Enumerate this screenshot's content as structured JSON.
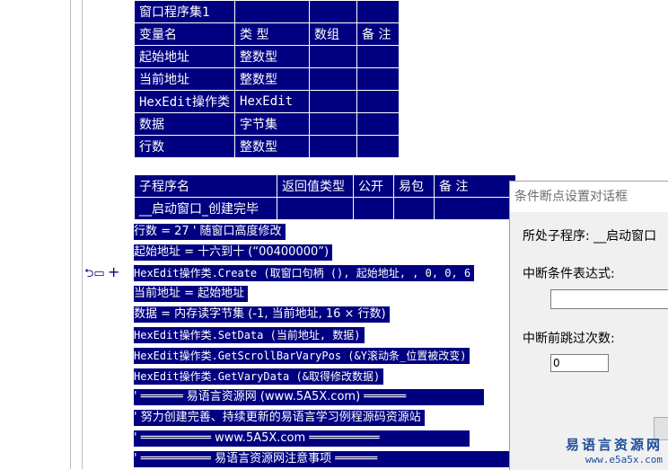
{
  "var_table": {
    "title": "窗口程序集1",
    "headers": [
      "变量名",
      "类 型",
      "数组",
      "备 注"
    ],
    "rows": [
      [
        "起始地址",
        "整数型"
      ],
      [
        "当前地址",
        "整数型"
      ],
      [
        "HexEdit操作类",
        "HexEdit"
      ],
      [
        "数据",
        "字节集"
      ],
      [
        "行数",
        "整数型"
      ]
    ]
  },
  "sub_table": {
    "headers": [
      "子程序名",
      "返回值类型",
      "公开",
      "易包",
      "备 注"
    ],
    "row": [
      "__启动窗口_创建完毕"
    ]
  },
  "code_lines": [
    "行数 = 27  ' 随窗口高度修改",
    "起始地址 = 十六到十 (“00400000”)",
    "HexEdit操作类.Create (取窗口句柄 (), 起始地址, , 0, 0, 6",
    "当前地址 = 起始地址",
    "数据 = 内存读字节集 (-1, 当前地址, 16 × 行数)",
    "HexEdit操作类.SetData (当前地址, 数据)",
    "HexEdit操作类.GetScrollBarVaryPos (&Y滚动条_位置被改变)",
    "HexEdit操作类.GetVaryData (&取得修改数据)",
    "' ══════  易语言资源网 (www.5A5X.com) ══════",
    "' 努力创建完善、持续更新的易语言学习例程源码资源站",
    "' ══════════  www.5A5X.com  ══════════",
    "' ══════════  易语言资源网注意事项  ══════"
  ],
  "dialog": {
    "title": "条件断点设置对话框",
    "sub_label": "所处子程序: __启动窗口",
    "cond_label": "中断条件表达式:",
    "cond_value": "",
    "skip_label": "中断前跳过次数:",
    "skip_value": "0"
  },
  "watermark": {
    "line1": "易语言资源网",
    "line2": "www.e5a5x.com"
  }
}
